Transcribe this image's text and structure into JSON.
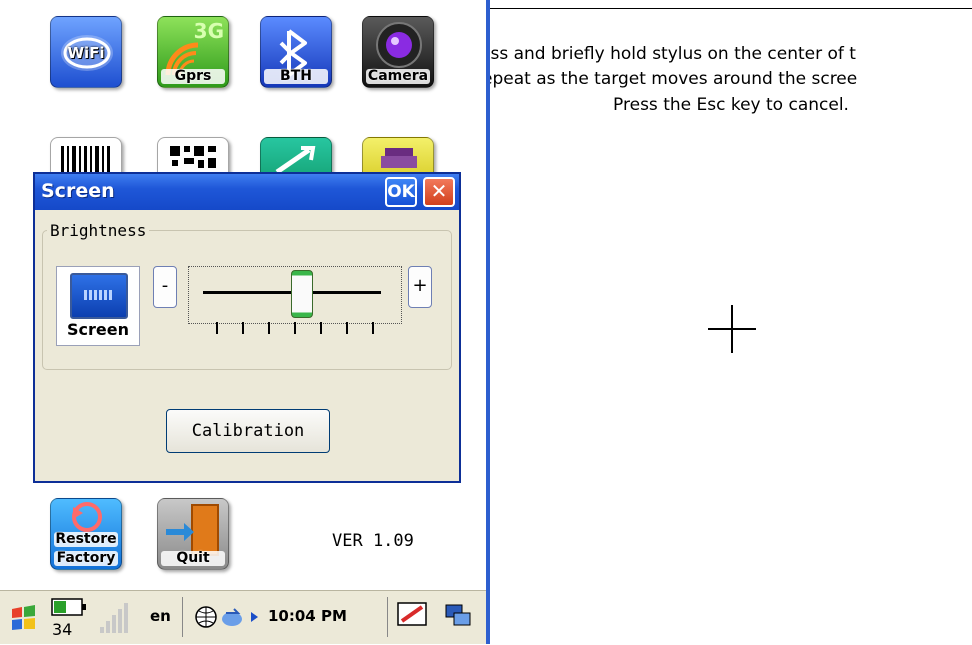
{
  "apps_top": [
    {
      "label": "WiFi"
    },
    {
      "label": "Gprs",
      "badge": "3G"
    },
    {
      "label": "BTH"
    },
    {
      "label": "Camera"
    }
  ],
  "apps_bottom": [
    {
      "label": "Restore"
    },
    {
      "label": "Factory"
    },
    {
      "label": "Quit"
    }
  ],
  "dialog": {
    "title": "Screen",
    "ok_label": "OK",
    "close_label": "✕",
    "group_label": "Brightness",
    "screen_button_label": "Screen",
    "minus_label": "-",
    "plus_label": "+",
    "brightness_level": 0.55,
    "calibration_label": "Calibration"
  },
  "version": "VER 1.09",
  "taskbar": {
    "battery_level": "34",
    "language": "en",
    "clock": "10:04 PM"
  },
  "calibration": {
    "line1": "ess and briefly hold stylus on the center of t",
    "line2": "epeat as the target moves around the scree",
    "line3": "Press the Esc key to cancel."
  },
  "colors": {
    "titlebar": "#1f57d8",
    "dialog_bg": "#ece9d8",
    "close_red": "#d2401c",
    "slider_green": "#3ab64a"
  }
}
